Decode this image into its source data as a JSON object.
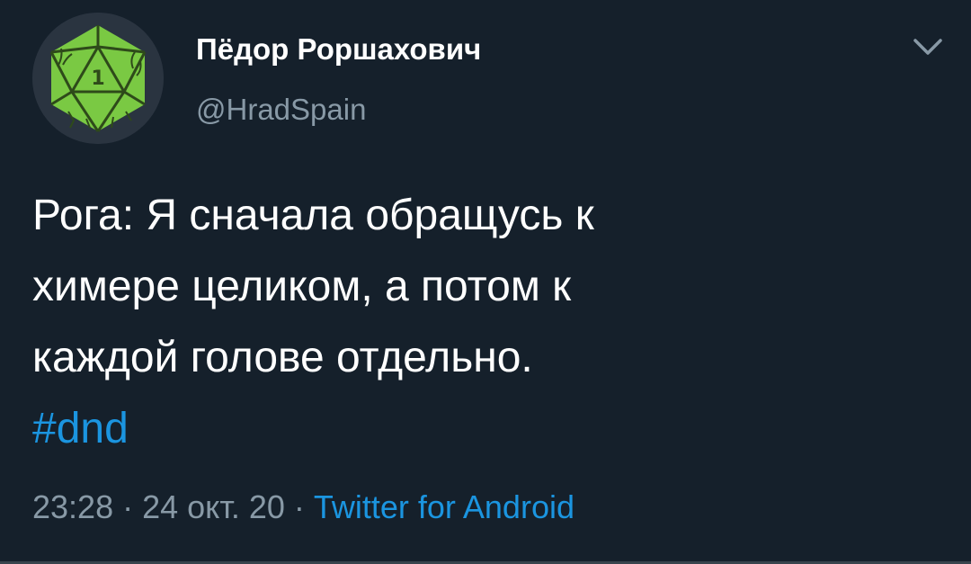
{
  "user": {
    "display_name": "Пёдор Роршахович",
    "handle": "@HradSpain",
    "avatar_icon": "d20-die-icon",
    "avatar_number": "1"
  },
  "tweet": {
    "lines": [
      "Рога: Я сначала обращусь к",
      "химере целиком, а потом к",
      "каждой голове отдельно."
    ],
    "hashtag": "#dnd"
  },
  "meta": {
    "time": "23:28",
    "separator1": " · ",
    "date": "24 окт. 20",
    "separator2": " · ",
    "source": "Twitter for Android"
  },
  "colors": {
    "background": "#15202b",
    "text": "#ffffff",
    "secondary": "#8899a6",
    "accent": "#1b95e0",
    "avatar_green": "#7ac943"
  }
}
